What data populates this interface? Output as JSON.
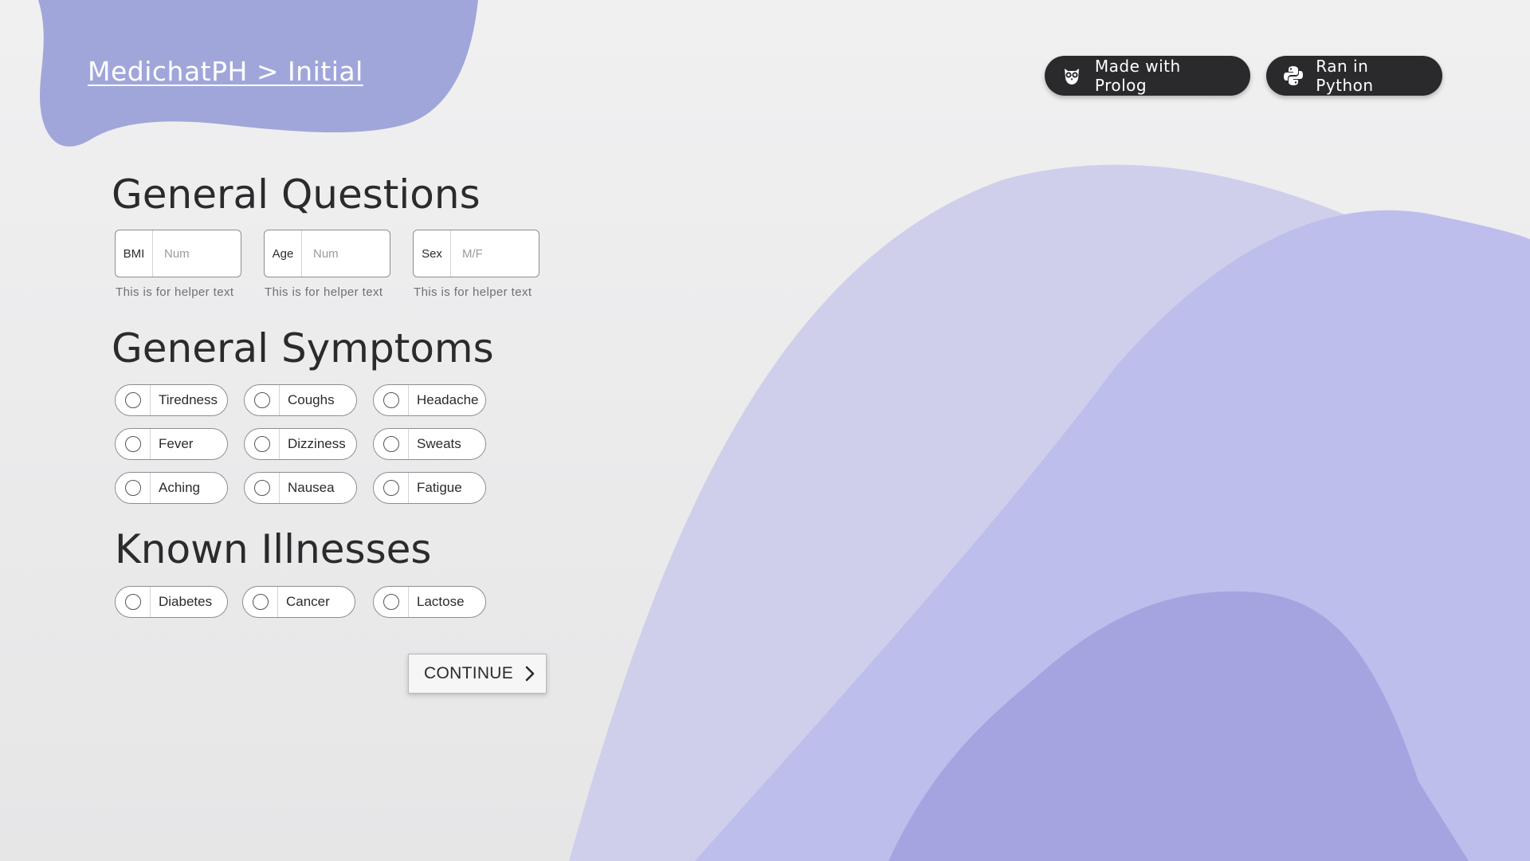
{
  "breadcrumb": "MedichatPH > Initial",
  "badges": [
    {
      "label": "Made with Prolog",
      "icon": "owl-icon"
    },
    {
      "label": "Ran in Python",
      "icon": "python-icon"
    }
  ],
  "general_questions": {
    "title": "General Questions",
    "fields": [
      {
        "label": "BMI",
        "placeholder": "Num",
        "helper": "This is for helper text"
      },
      {
        "label": "Age",
        "placeholder": "Num",
        "helper": "This is for helper text"
      },
      {
        "label": "Sex",
        "placeholder": "M/F",
        "helper": "This is for helper text"
      }
    ]
  },
  "general_symptoms": {
    "title": "General Symptoms",
    "options": [
      "Tiredness",
      "Coughs",
      "Headache",
      "Fever",
      "Dizziness",
      "Sweats",
      "Aching",
      "Nausea",
      "Fatigue"
    ]
  },
  "known_illnesses": {
    "title": "Known Illnesses",
    "options": [
      "Diabetes",
      "Cancer",
      "Lactose"
    ]
  },
  "continue_label": "CONTINUE",
  "colors": {
    "accent": "#a0a6da",
    "wave_light": "#cfcfec",
    "wave_mid": "#bebeed",
    "wave_dark": "#a4a4e0",
    "badge_bg": "#2a2a2d"
  }
}
